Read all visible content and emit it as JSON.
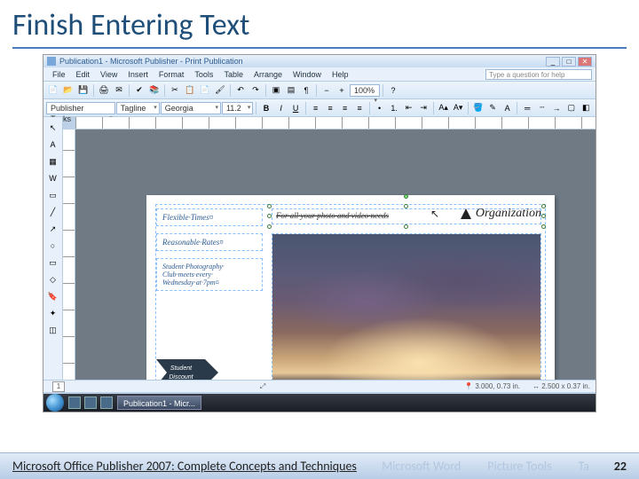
{
  "slide": {
    "title": "Finish Entering Text",
    "footer_text": "Microsoft Office Publisher 2007: Complete Concepts and Techniques",
    "page_number": "22",
    "ghost1": "Microsoft Word",
    "ghost2": "Picture Tools",
    "ghost3": "Ta"
  },
  "titlebar": {
    "text": "Publication1 - Microsoft Publisher - Print Publication"
  },
  "menu": {
    "items": [
      "File",
      "Edit",
      "View",
      "Insert",
      "Format",
      "Tools",
      "Table",
      "Arrange",
      "Window",
      "Help"
    ],
    "ask_placeholder": "Type a question for help"
  },
  "toolbar2": {
    "tasks_label": "Publisher Tasks",
    "tagline_label": "Tagline",
    "font_name": "Georgia",
    "font_size": "11.2",
    "zoom": "100%"
  },
  "page": {
    "left_items": {
      "a": "Flexible·Times¤",
      "b": "Reasonable·Rates¤",
      "c": "Student·Photography·\nClub·meets·every·\nWednesday·at·7pm¤"
    },
    "badge_line1": "Student",
    "badge_line2": "Discount",
    "tagline_text": "For·all·your·photo·and·video·needs",
    "org_label": "Organization"
  },
  "status": {
    "page_current": "1",
    "coords": "3.000, 0.73 in.",
    "size": "2.500 x 0.37 in."
  },
  "taskbar": {
    "item": "Publication1 - Micr..."
  }
}
